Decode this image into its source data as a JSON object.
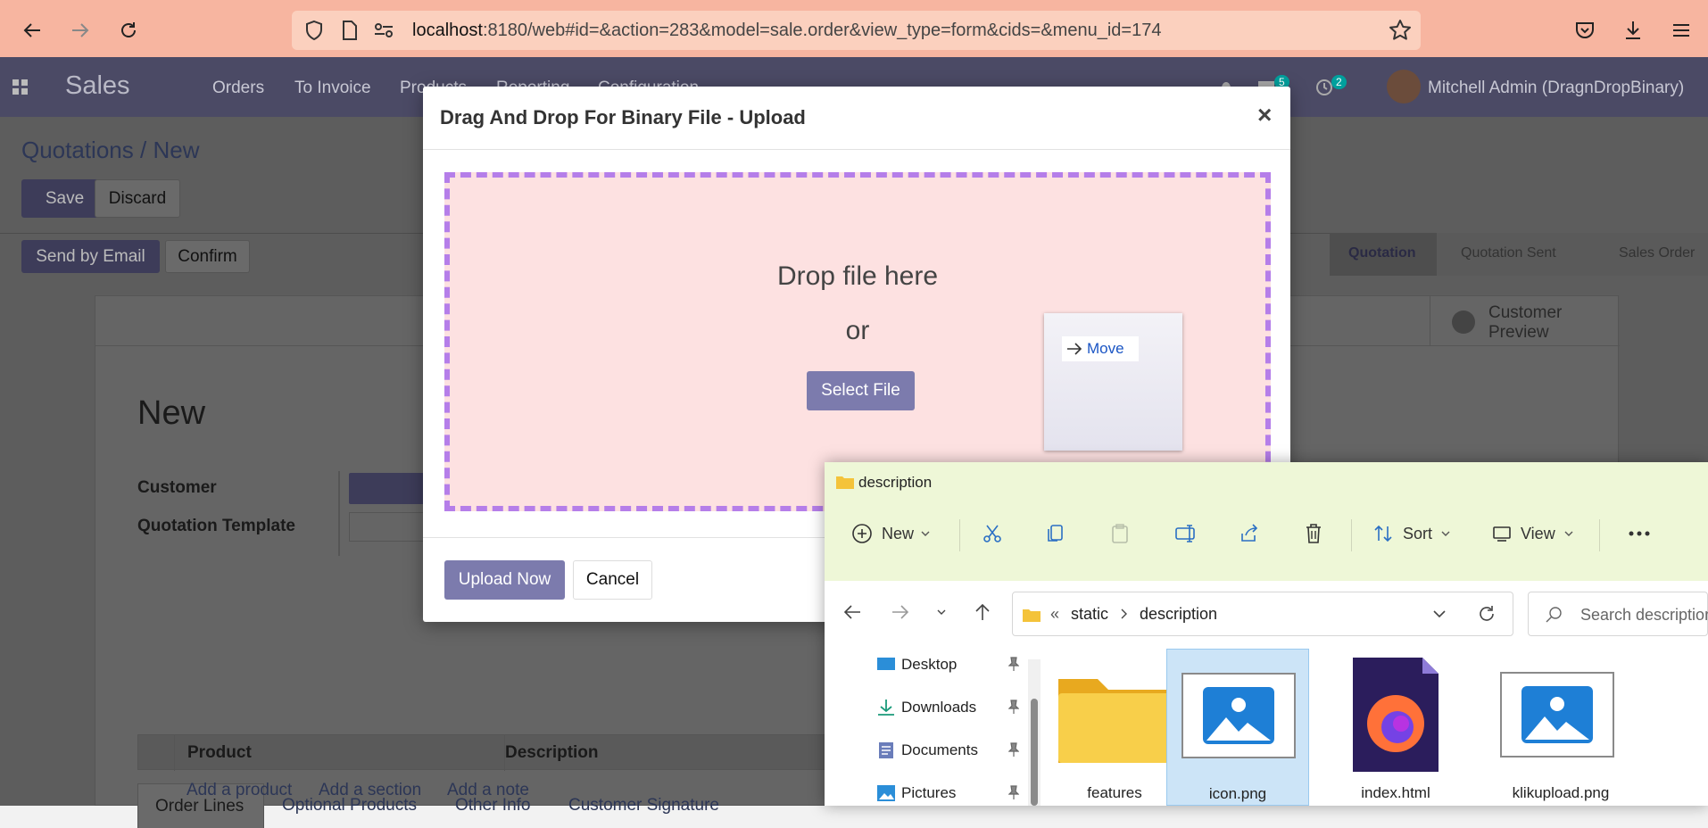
{
  "browser": {
    "url_host": "localhost",
    "url_rest": ":8180/web#id=&action=283&model=sale.order&view_type=form&cids=&menu_id=174"
  },
  "nav": {
    "app_name": "Sales",
    "menu": [
      "Orders",
      "To Invoice",
      "Products",
      "Reporting",
      "Configuration"
    ],
    "messages_count": "5",
    "activities_count": "2",
    "user": "Mitchell Admin (DragnDropBinary)"
  },
  "page": {
    "breadcrumb_parent": "Quotations",
    "breadcrumb_sep": "/",
    "breadcrumb_current": "New",
    "save_label": "Save",
    "discard_label": "Discard",
    "send_email_label": "Send by Email",
    "confirm_label": "Confirm",
    "status_steps": [
      "Quotation",
      "Quotation Sent",
      "Sales Order"
    ],
    "customer_preview_label_1": "Customer",
    "customer_preview_label_2": "Preview",
    "record_title": "New",
    "field_customer": "Customer",
    "field_template": "Quotation Template",
    "tabs": [
      "Order Lines",
      "Optional Products",
      "Other Info",
      "Customer Signature"
    ],
    "col_product": "Product",
    "col_description": "Description",
    "add_product": "Add a product",
    "add_section": "Add a section",
    "add_note": "Add a note"
  },
  "modal": {
    "title": "Drag And Drop For Binary File - Upload",
    "close": "×",
    "drop_text": "Drop file here",
    "or_text": "or",
    "select_file": "Select File",
    "move_label": "Move",
    "upload_now": "Upload Now",
    "cancel": "Cancel"
  },
  "explorer": {
    "title": "description",
    "new_label": "New",
    "sort_label": "Sort",
    "view_label": "View",
    "path_prefix": "«",
    "path_static": "static",
    "path_description": "description",
    "search_placeholder": "Search description",
    "sidebar": [
      "Desktop",
      "Downloads",
      "Documents",
      "Pictures"
    ],
    "files": [
      "features",
      "icon.png",
      "index.html",
      "klikupload.png"
    ]
  },
  "colors": {
    "odoo_nav": "#4b4a65",
    "odoo_primary": "#7c7bad",
    "dropzone_bg": "#fde1e1",
    "dropzone_border": "#b57ee9",
    "explorer_title_bg": "#eef7d7",
    "browser_bar": "#f7b5a0"
  }
}
